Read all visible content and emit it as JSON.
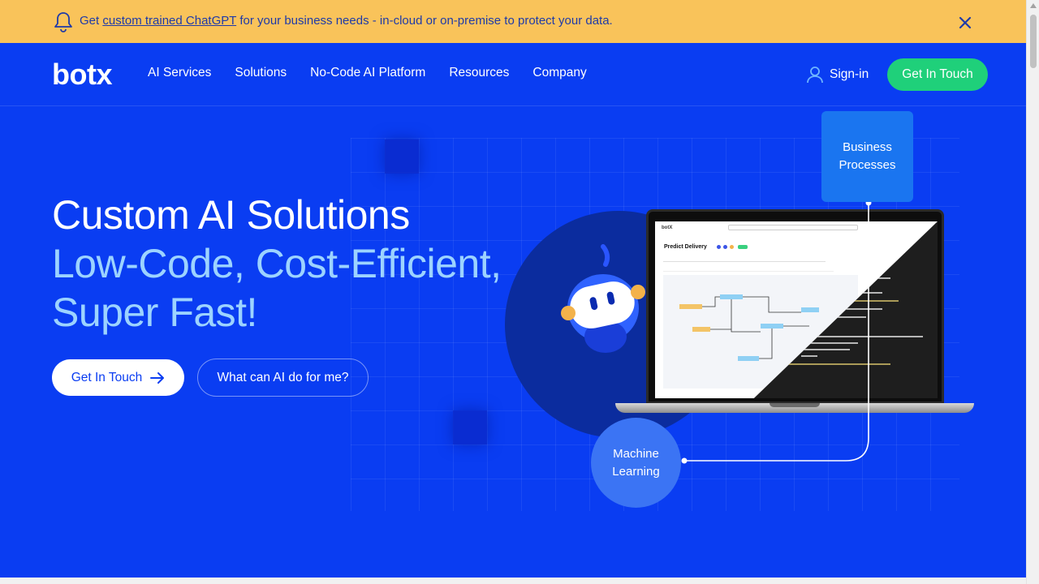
{
  "announcement": {
    "prefix": "Get ",
    "link": "custom trained ChatGPT",
    "suffix": " for your business needs - in-cloud or on-premise to protect your data."
  },
  "nav": {
    "logo": "botx",
    "items": [
      {
        "label": "AI Services"
      },
      {
        "label": "Solutions"
      },
      {
        "label": "No-Code AI Platform"
      },
      {
        "label": "Resources"
      },
      {
        "label": "Company"
      }
    ],
    "signin": "Sign-in",
    "cta": "Get In Touch"
  },
  "hero": {
    "line1": "Custom AI Solutions",
    "line2": "Low-Code, Cost-Efficient,",
    "line3": "Super Fast!",
    "primary_button": "Get In Touch",
    "secondary_button": "What can AI do for me?"
  },
  "illustration": {
    "business_processes": "Business Processes",
    "machine_learning": "Machine Learning",
    "screen_app": "botX",
    "screen_title": "Predict Delivery"
  },
  "colors": {
    "background": "#0a3df2",
    "announcement_bg": "#f9c35a",
    "cta_green": "#1fd07a",
    "accent_light_blue": "#9cd3ff"
  }
}
